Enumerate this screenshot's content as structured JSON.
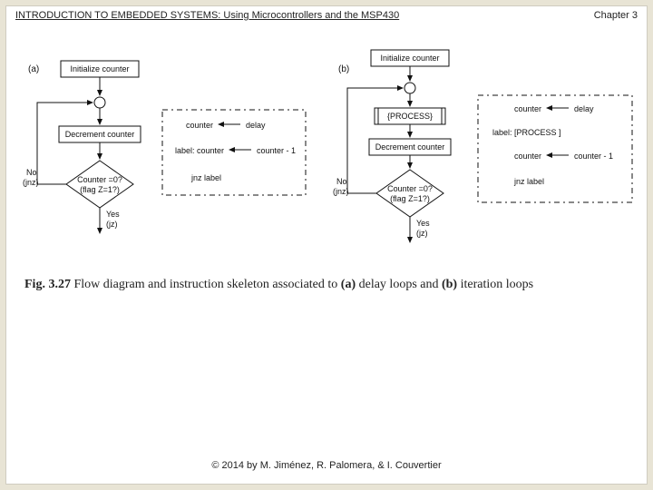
{
  "header": {
    "title": "INTRODUCTION TO EMBEDDED SYSTEMS: Using Microcontrollers and the MSP430",
    "chapter": "Chapter 3"
  },
  "diagram": {
    "a": {
      "label": "(a)",
      "init": "Initialize counter",
      "decrement": "Decrement counter",
      "cond_l1": "Counter =0?",
      "cond_l2": "(flag Z=1?)",
      "no_l1": "No",
      "no_l2": "(jnz)",
      "yes_l1": "Yes",
      "yes_l2": "(jz)",
      "code_l1_left": "counter",
      "code_l1_right": "delay",
      "code_l2_left": "label:   counter",
      "code_l2_right": "counter - 1",
      "code_l3": "jnz   label"
    },
    "b": {
      "label": "(b)",
      "init": "Initialize counter",
      "process": "{PROCESS}",
      "decrement": "Decrement counter",
      "cond_l1": "Counter =0?",
      "cond_l2": "(flag Z=1?)",
      "no_l1": "No",
      "no_l2": "(jnz)",
      "yes_l1": "Yes",
      "yes_l2": "(jz)",
      "code_l1_left": "counter",
      "code_l1_right": "delay",
      "code_l2": "label:   [PROCESS ]",
      "code_l3_left": "counter",
      "code_l3_right": "counter - 1",
      "code_l4": "jnz   label"
    }
  },
  "caption": {
    "fignum": "Fig. 3.27",
    "text_part1": "  Flow diagram and instruction skeleton associated to ",
    "a": "(a)",
    "text_part2": " delay loops and ",
    "b": "(b)",
    "text_part3": " iteration loops"
  },
  "footer": {
    "text": "© 2014 by M. Jiménez, R. Palomera, & I. Couvertier"
  }
}
